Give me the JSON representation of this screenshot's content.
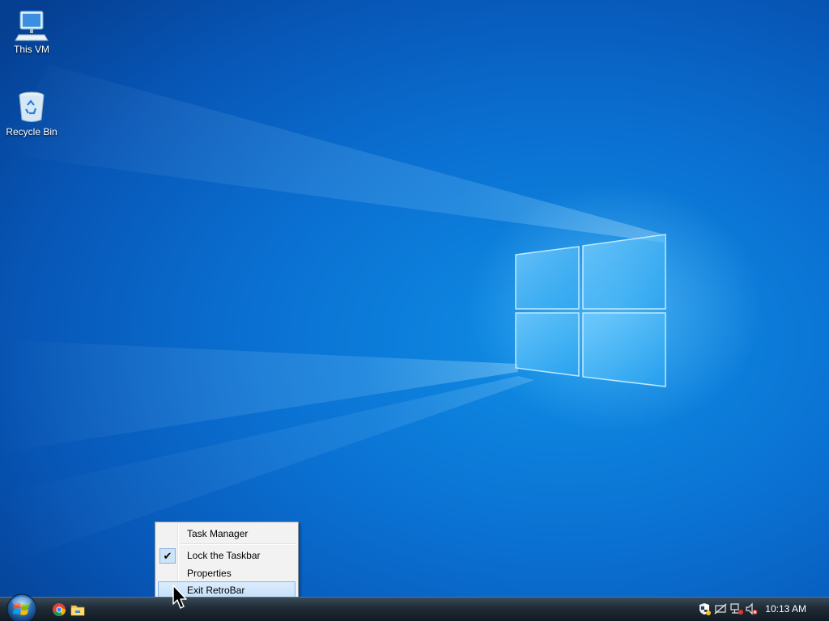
{
  "desktop": {
    "icons": [
      {
        "label": "This VM",
        "icon": "computer-icon"
      },
      {
        "label": "Recycle Bin",
        "icon": "recycle-bin-icon"
      }
    ]
  },
  "context_menu": {
    "items": [
      {
        "label": "Task Manager",
        "checked": false,
        "highlighted": false
      },
      {
        "label": "Lock the Taskbar",
        "checked": true,
        "highlighted": false
      },
      {
        "label": "Properties",
        "checked": false,
        "highlighted": false
      },
      {
        "label": "Exit RetroBar",
        "checked": false,
        "highlighted": true
      }
    ],
    "check_glyph": "✔"
  },
  "taskbar": {
    "start_icon": "windows-orb-icon",
    "quick_launch": [
      {
        "icon": "chrome-icon"
      },
      {
        "icon": "file-explorer-icon"
      }
    ],
    "tray": {
      "icons": [
        "security-shield-icon",
        "notifications-off-icon",
        "network-disconnected-icon",
        "volume-muted-icon"
      ],
      "clock": "10:13 AM"
    }
  },
  "colors": {
    "desktop_blue": "#0a6fd0",
    "menu_highlight": "#c5e0fa",
    "menu_highlight_border": "#7eb4ea"
  }
}
